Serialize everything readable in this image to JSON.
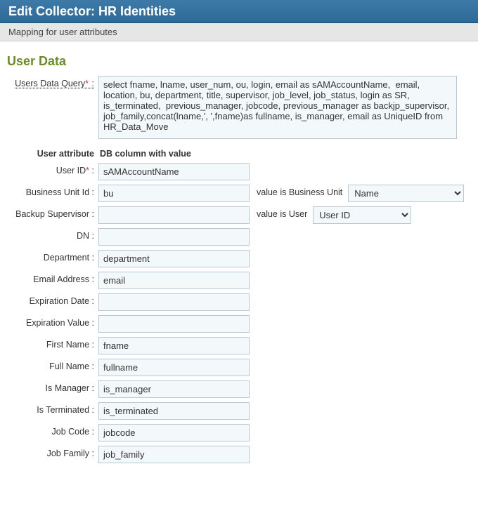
{
  "header": {
    "title": "Edit Collector: HR Identities",
    "subtitle": "Mapping for user attributes"
  },
  "section_title": "User Data",
  "query": {
    "label": "Users Data Query",
    "required": true,
    "value": "select fname, lname, user_num, ou, login, email as sAMAccountName,  email, location, bu, department, title, supervisor, job_level, job_status, login as SR, is_terminated,  previous_manager, jobcode, previous_manager as backjp_supervisor, job_family,concat(lname,', ',fname)as fullname, is_manager, email as UniqueID from HR_Data_Move"
  },
  "attr_header": {
    "left": "User attribute",
    "right": "DB column with value"
  },
  "rows": {
    "user_id": {
      "label": "User ID",
      "required": true,
      "value": "sAMAccountName"
    },
    "business_unit": {
      "label": "Business Unit Id",
      "value": "bu",
      "midlabel": "value is Business Unit",
      "select_value": "Name"
    },
    "backup_sup": {
      "label": "Backup Supervisor",
      "value": "",
      "midlabel": "value is User",
      "select_value": "User ID"
    },
    "dn": {
      "label": "DN",
      "value": ""
    },
    "department": {
      "label": "Department",
      "value": "department"
    },
    "email": {
      "label": "Email Address",
      "value": "email"
    },
    "exp_date": {
      "label": "Expiration Date",
      "value": ""
    },
    "exp_value": {
      "label": "Expiration Value",
      "value": ""
    },
    "first_name": {
      "label": "First Name",
      "value": "fname"
    },
    "full_name": {
      "label": "Full Name",
      "value": "fullname"
    },
    "is_manager": {
      "label": "Is Manager",
      "value": "is_manager"
    },
    "is_terminated": {
      "label": "Is Terminated",
      "value": "is_terminated"
    },
    "job_code": {
      "label": "Job Code",
      "value": "jobcode"
    },
    "job_family": {
      "label": "Job Family",
      "value": "job_family"
    }
  }
}
